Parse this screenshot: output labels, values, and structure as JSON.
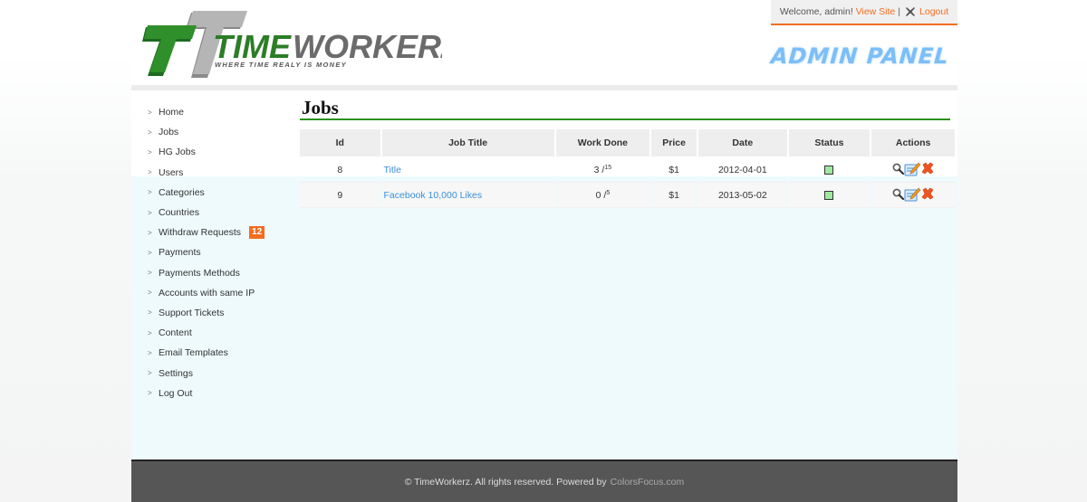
{
  "brand": {
    "name_green": "TIME",
    "name_gray": "WORKERZ",
    "tagline": "WHERE TIME REALY IS MONEY",
    "panel_title": "ADMIN PANEL"
  },
  "topbar": {
    "welcome": "Welcome, admin!",
    "view_site": "View Site",
    "separator": "|",
    "logout": "Logout",
    "logout_icon": "close-x-icon"
  },
  "sidebar": {
    "items": [
      {
        "label": "Home"
      },
      {
        "label": "Jobs"
      },
      {
        "label": "HG Jobs"
      },
      {
        "label": "Users"
      },
      {
        "label": "Categories"
      },
      {
        "label": "Countries"
      },
      {
        "label": "Withdraw Requests",
        "badge": "12"
      },
      {
        "label": "Payments"
      },
      {
        "label": "Payments Methods"
      },
      {
        "label": "Accounts with same IP"
      },
      {
        "label": "Support Tickets"
      },
      {
        "label": "Content"
      },
      {
        "label": "Email Templates"
      },
      {
        "label": "Settings"
      },
      {
        "label": "Log Out"
      }
    ]
  },
  "main": {
    "title": "Jobs",
    "table": {
      "columns": [
        "Id",
        "Job Title",
        "Work Done",
        "Price",
        "Date",
        "Status",
        "Actions"
      ],
      "rows": [
        {
          "id": "8",
          "title": "Title",
          "work_done": "3",
          "work_total": "15",
          "price": "$1",
          "date": "2012-04-01",
          "status": "active"
        },
        {
          "id": "9",
          "title": "Facebook 10,000 Likes",
          "work_done": "0",
          "work_total": "5",
          "price": "$1",
          "date": "2013-05-02",
          "status": "active"
        }
      ]
    }
  },
  "footer": {
    "text": "© TimeWorkerz. All rights reserved. Powered by",
    "link": "ColorsFocus.com"
  },
  "colors": {
    "accent_orange": "#f36d21",
    "title_rule_green": "#2f8f1f",
    "link_blue": "#3a8fd9",
    "status_active": "#9fe89f"
  }
}
